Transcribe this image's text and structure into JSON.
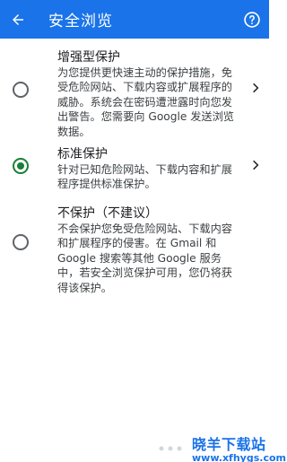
{
  "appbar": {
    "title": "安全浏览",
    "back_icon": "arrow-left-icon",
    "help_icon": "help-circle-icon",
    "color": "#1a73e8"
  },
  "options": [
    {
      "title": "增强型保护",
      "description": "为您提供更快速主动的保护措施，免受危险网站、下载内容或扩展程序的威胁。系统会在密码遭泄露时向您发出警告。您需要向 Google 发送浏览数据。",
      "selected": false,
      "has_chevron": true
    },
    {
      "title": "标准保护",
      "description": "针对已知危险网站、下载内容和扩展程序提供标准保护。",
      "selected": true,
      "has_chevron": true
    },
    {
      "title": "不保护（不建议）",
      "description": "不会保护您免受危险网站、下载内容和扩展程序的侵害。在 Gmail 和 Google 搜索等其他 Google 服务中，若安全浏览保护可用，您仍将获得该保护。",
      "selected": false,
      "has_chevron": false
    }
  ],
  "watermark": {
    "brand": "晓羊下载站",
    "url": "www.xfhygs.com"
  },
  "colors": {
    "selected_radio": "#188038",
    "radio": "#5f6368"
  }
}
